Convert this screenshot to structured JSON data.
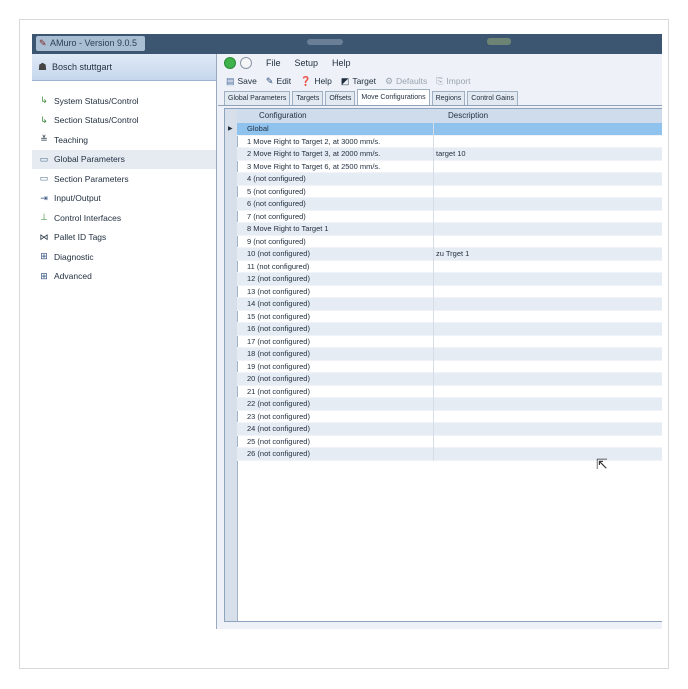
{
  "window": {
    "title": "AMuro - Version 9.0.5"
  },
  "location": {
    "label": "Bosch stuttgart"
  },
  "nav": {
    "items": [
      {
        "label": "System Status/Control",
        "icon": "status-control-icon"
      },
      {
        "label": "Section Status/Control",
        "icon": "status-control-icon"
      },
      {
        "label": "Teaching",
        "icon": "teaching-icon"
      },
      {
        "label": "Global Parameters",
        "icon": "parameters-icon"
      },
      {
        "label": "Section Parameters",
        "icon": "parameters-icon"
      },
      {
        "label": "Input/Output",
        "icon": "io-icon"
      },
      {
        "label": "Control Interfaces",
        "icon": "interfaces-icon"
      },
      {
        "label": "Pallet ID Tags",
        "icon": "tags-icon"
      },
      {
        "label": "Diagnostic",
        "icon": "expand-icon"
      },
      {
        "label": "Advanced",
        "icon": "expand-icon"
      }
    ]
  },
  "menu": {
    "file": "File",
    "setup": "Setup",
    "help": "Help"
  },
  "toolbar": {
    "save": "Save",
    "edit": "Edit",
    "help": "Help",
    "target": "Target",
    "defaults": "Defaults",
    "import": "Import"
  },
  "tabs": [
    "Global Parameters",
    "Targets",
    "Offsets",
    "Move Configurations",
    "Regions",
    "Control Gains"
  ],
  "grid": {
    "columns": [
      "Configuration",
      "Description"
    ],
    "rows": [
      {
        "configuration": "Global",
        "description": ""
      },
      {
        "configuration": "1 Move Right to Target 2, at 3000 mm/s.",
        "description": ""
      },
      {
        "configuration": "2 Move Right to Target 3, at 2000 mm/s.",
        "description": "target 10"
      },
      {
        "configuration": "3 Move Right to Target 6, at 2500 mm/s.",
        "description": ""
      },
      {
        "configuration": "4 (not configured)",
        "description": ""
      },
      {
        "configuration": "5 (not configured)",
        "description": ""
      },
      {
        "configuration": "6 (not configured)",
        "description": ""
      },
      {
        "configuration": "7 (not configured)",
        "description": ""
      },
      {
        "configuration": "8 Move Right to Target 1",
        "description": ""
      },
      {
        "configuration": "9 (not configured)",
        "description": ""
      },
      {
        "configuration": "10 (not configured)",
        "description": "zu Trget 1"
      },
      {
        "configuration": "11 (not configured)",
        "description": ""
      },
      {
        "configuration": "12 (not configured)",
        "description": ""
      },
      {
        "configuration": "13 (not configured)",
        "description": ""
      },
      {
        "configuration": "14 (not configured)",
        "description": ""
      },
      {
        "configuration": "15 (not configured)",
        "description": ""
      },
      {
        "configuration": "16 (not configured)",
        "description": ""
      },
      {
        "configuration": "17 (not configured)",
        "description": ""
      },
      {
        "configuration": "18 (not configured)",
        "description": ""
      },
      {
        "configuration": "19 (not configured)",
        "description": ""
      },
      {
        "configuration": "20 (not configured)",
        "description": ""
      },
      {
        "configuration": "21 (not configured)",
        "description": ""
      },
      {
        "configuration": "22 (not configured)",
        "description": ""
      },
      {
        "configuration": "23 (not configured)",
        "description": ""
      },
      {
        "configuration": "24 (not configured)",
        "description": ""
      },
      {
        "configuration": "25 (not configured)",
        "description": ""
      },
      {
        "configuration": "26 (not configured)",
        "description": ""
      }
    ]
  },
  "colors": {
    "titlebar": "#3c5571",
    "selection": "#8fc3ee",
    "header": "#cfdcec"
  }
}
